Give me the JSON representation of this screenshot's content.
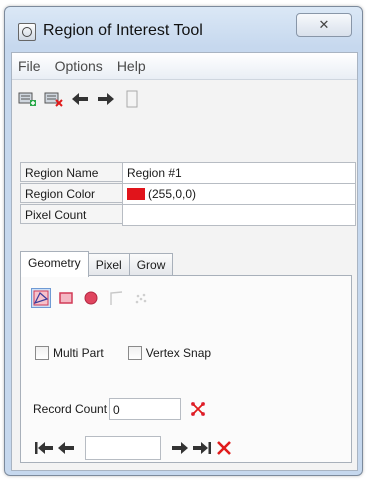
{
  "window": {
    "title": "Region of Interest Tool",
    "close_symbol": "✕"
  },
  "menu": [
    "File",
    "Options",
    "Help"
  ],
  "toolbar": {
    "icons": [
      "new-roi-icon",
      "delete-roi-icon",
      "arrow-left-icon",
      "arrow-right-icon",
      "blank-page-icon"
    ]
  },
  "properties": {
    "region_name_label": "Region Name",
    "region_name_value": "Region #1",
    "region_color_label": "Region Color",
    "region_color_value": "(255,0,0)",
    "region_color_hex": "#e1141b",
    "pixel_count_label": "Pixel Count",
    "pixel_count_value": ""
  },
  "tabs": [
    "Geometry",
    "Pixel",
    "Grow"
  ],
  "geometry": {
    "tools": [
      "polygon-tool-icon",
      "rectangle-tool-icon",
      "ellipse-tool-icon",
      "polyline-tool-icon",
      "point-tool-icon"
    ],
    "multi_part_label": "Multi Part",
    "vertex_snap_label": "Vertex Snap",
    "record_count_label": "Record Count",
    "record_count_value": "0",
    "record_nav_value": ""
  }
}
